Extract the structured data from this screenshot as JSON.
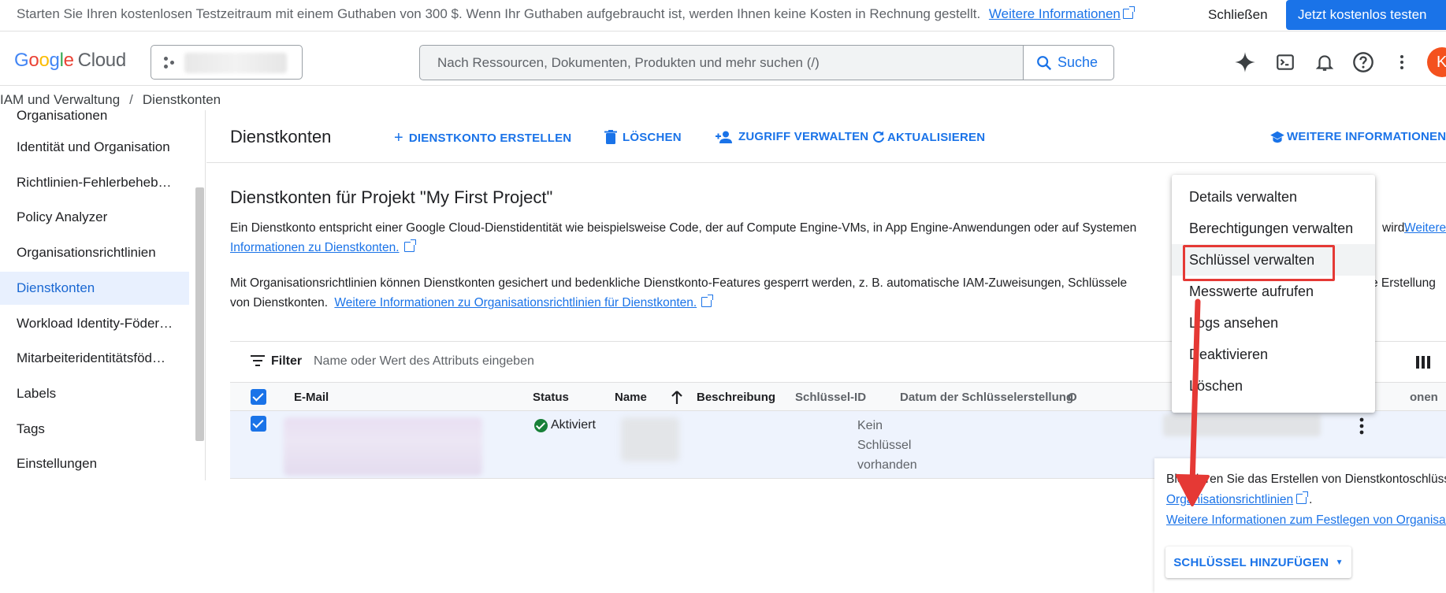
{
  "promo": {
    "text": "Starten Sie Ihren kostenlosen Testzeitraum mit einem Guthaben von 300 $. Wenn Ihr Guthaben aufgebraucht ist, werden Ihnen keine Kosten in Rechnung gestellt.",
    "link": "Weitere Informationen",
    "close": "Schließen",
    "cta": "Jetzt kostenlos testen"
  },
  "header": {
    "logo_google": "Google",
    "logo_cloud": "Cloud",
    "search_placeholder": "Nach Ressourcen, Dokumenten, Produkten und mehr suchen (/)",
    "search_button": "Suche",
    "avatar_initial": "K",
    "icons": [
      "gemini-icon",
      "cloud-shell-icon",
      "notifications-icon",
      "help-icon",
      "more-vert-icon"
    ]
  },
  "breadcrumb": {
    "items": [
      "IAM und Verwaltung",
      "Dienstkonten"
    ],
    "separator": "/"
  },
  "sidebar": {
    "items": [
      {
        "label": "Organisationen"
      },
      {
        "label": "Identität und Organisation"
      },
      {
        "label": "Richtlinien-Fehlerbehebung"
      },
      {
        "label": "Policy Analyzer"
      },
      {
        "label": "Organisationsrichtlinien"
      },
      {
        "label": "Dienstkonten"
      },
      {
        "label": "Workload Identity-Föderation"
      },
      {
        "label": "Mitarbeiteridentitätsföderation"
      },
      {
        "label": "Labels"
      },
      {
        "label": "Tags"
      },
      {
        "label": "Einstellungen"
      }
    ]
  },
  "toolbar": {
    "title": "Dienstkonten",
    "create": "DIENSTKONTO ERSTELLEN",
    "delete": "LÖSCHEN",
    "manage_access": "ZUGRIFF VERWALTEN",
    "refresh": "AKTUALISIEREN",
    "learn_more": "WEITERE INFORMATIONEN"
  },
  "main": {
    "section_title": "Dienstkonten für Projekt \"My First Project\"",
    "para1_text": "Ein Dienstkonto entspricht einer Google Cloud-Dienstidentität wie beispielsweise Code, der auf Compute Engine-VMs, in App Engine-Anwendungen oder auf Systemen",
    "para1_tail": "wird.",
    "para1_link": "Weitere",
    "para1_link2": "Informationen zu Dienstkonten.",
    "para2_text": "Mit Organisationsrichtlinien können Dienstkonten gesichert und bedenkliche Dienstkonto-Features gesperrt werden, z. B. automatische IAM-Zuweisungen, Schlüssele",
    "para2_tail": "e Erstellung",
    "para2_line2": "von Dienstkonten.",
    "para2_link": "Weitere Informationen zu Organisationsrichtlinien für Dienstkonten."
  },
  "table": {
    "filter_label": "Filter",
    "filter_placeholder": "Name oder Wert des Attributs eingeben",
    "columns": {
      "email": "E-Mail",
      "status": "Status",
      "name": "Name",
      "description": "Beschreibung",
      "key_id": "Schlüssel-ID",
      "key_date": "Datum der Schlüsselerstellung",
      "org_partial": "O",
      "actions_partial": "onen"
    },
    "rows": [
      {
        "status": "Aktiviert",
        "key_id": "Kein Schlüssel vorhanden"
      }
    ]
  },
  "menu": {
    "items": [
      {
        "label": "Details verwalten"
      },
      {
        "label": "Berechtigungen verwalten"
      },
      {
        "label": "Schlüssel verwalten"
      },
      {
        "label": "Messwerte aufrufen"
      },
      {
        "label": "Logs ansehen"
      },
      {
        "label": "Deaktivieren"
      },
      {
        "label": "Löschen"
      }
    ]
  },
  "side_panel": {
    "text": "Blockieren Sie das Erstellen von Dienstkontoschlüsse",
    "link1": "Organisationsrichtlinien",
    "link1_suffix": ".",
    "link2": "Weitere Informationen zum Festlegen von Organisati",
    "add_key_button": "SCHLÜSSEL HINZUFÜGEN"
  },
  "colors": {
    "accent": "#1a73e8",
    "highlight": "#e53935",
    "active_bg": "#e8f0fe",
    "status_green": "#188038"
  }
}
